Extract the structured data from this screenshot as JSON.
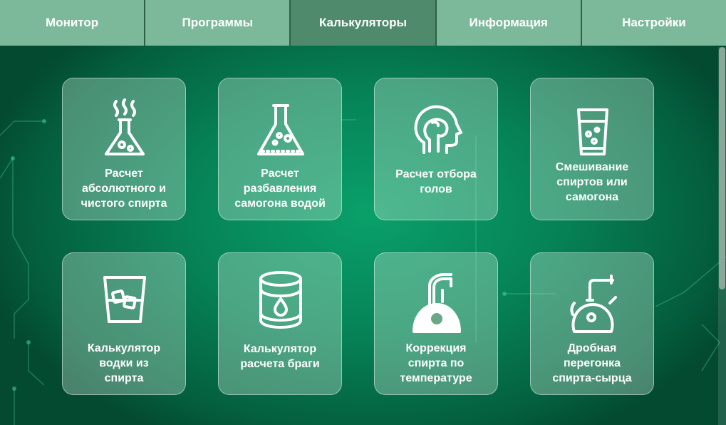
{
  "nav": {
    "tabs": [
      {
        "label": "Монитор"
      },
      {
        "label": "Программы"
      },
      {
        "label": "Калькуляторы",
        "active": true
      },
      {
        "label": "Информация"
      },
      {
        "label": "Настройки"
      }
    ]
  },
  "calculators": [
    {
      "label": "Расчет\nабсолютного и\nчистого спирта",
      "icon": "flask-steam-icon"
    },
    {
      "label": "Расчет\nразбавления\nсамогона водой",
      "icon": "flask-bubbles-icon"
    },
    {
      "label": "Расчет отбора\nголов",
      "icon": "head-profile-icon"
    },
    {
      "label": "Смешивание\nспиртов или\nсамогона",
      "icon": "glass-drink-icon"
    },
    {
      "label": "Калькулятор\nводки из\nспирта",
      "icon": "glass-ice-icon"
    },
    {
      "label": "Калькулятор\nрасчета браги",
      "icon": "barrel-drop-icon"
    },
    {
      "label": "Коррекция\nспирта по\nтемпературе",
      "icon": "still-tap-icon"
    },
    {
      "label": "Дробная\nперегонка\nспирта-сырца",
      "icon": "alembic-still-icon"
    }
  ],
  "colors": {
    "background": "#068458",
    "nav_bar": "#7cb99a",
    "nav_active": "#4f8a6c",
    "card": "#bee1cd"
  }
}
